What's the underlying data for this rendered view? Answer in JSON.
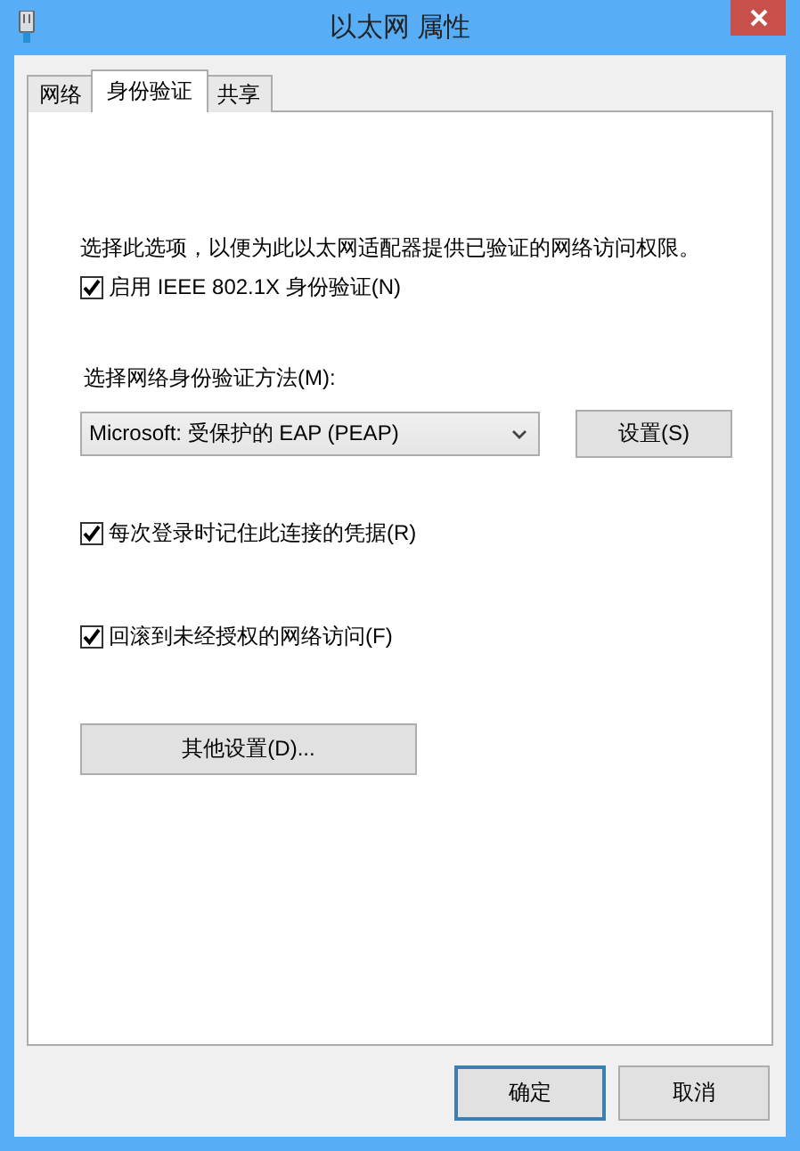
{
  "window": {
    "title": "以太网 属性"
  },
  "tabs": [
    {
      "label": "网络",
      "selected": false
    },
    {
      "label": "身份验证",
      "selected": true
    },
    {
      "label": "共享",
      "selected": false
    }
  ],
  "auth": {
    "description": "选择此选项，以便为此以太网适配器提供已验证的网络访问权限。",
    "enable_8021x": {
      "label": "启用 IEEE 802.1X 身份验证(N)",
      "checked": true
    },
    "method_label": "选择网络身份验证方法(M):",
    "method": {
      "value": "Microsoft: 受保护的 EAP (PEAP)"
    },
    "settings_button": "设置(S)",
    "remember": {
      "label": "每次登录时记住此连接的凭据(R)",
      "checked": true
    },
    "fallback": {
      "label": "回滚到未经授权的网络访问(F)",
      "checked": true
    },
    "more_button": "其他设置(D)..."
  },
  "buttons": [
    {
      "label": "确定",
      "default": true
    },
    {
      "label": "取消",
      "default": false
    }
  ]
}
